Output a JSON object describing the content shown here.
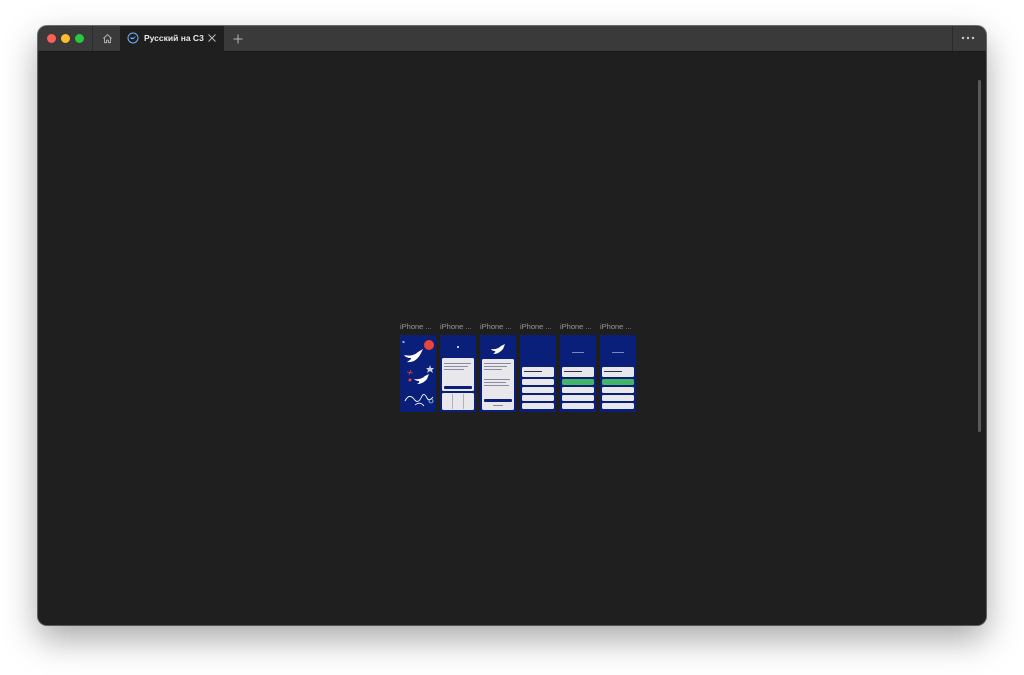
{
  "browser": {
    "home_icon": "home-icon",
    "tab": {
      "title": "Русский на С3",
      "icon": "swallow-icon",
      "close_icon": "close-icon"
    },
    "new_tab_icon": "plus-icon",
    "more_icon": "ellipsis-icon"
  },
  "frames": [
    {
      "label": "iPhone ..."
    },
    {
      "label": "iPhone ..."
    },
    {
      "label": "iPhone ..."
    },
    {
      "label": "iPhone ..."
    },
    {
      "label": "iPhone ..."
    },
    {
      "label": "iPhone ..."
    }
  ],
  "colors": {
    "window_bg": "#1f1f1f",
    "titlebar": "#3a3a3a",
    "phone_bg": "#0a1f7a",
    "accent_red": "#e8453c",
    "accent_green": "#42b566"
  }
}
